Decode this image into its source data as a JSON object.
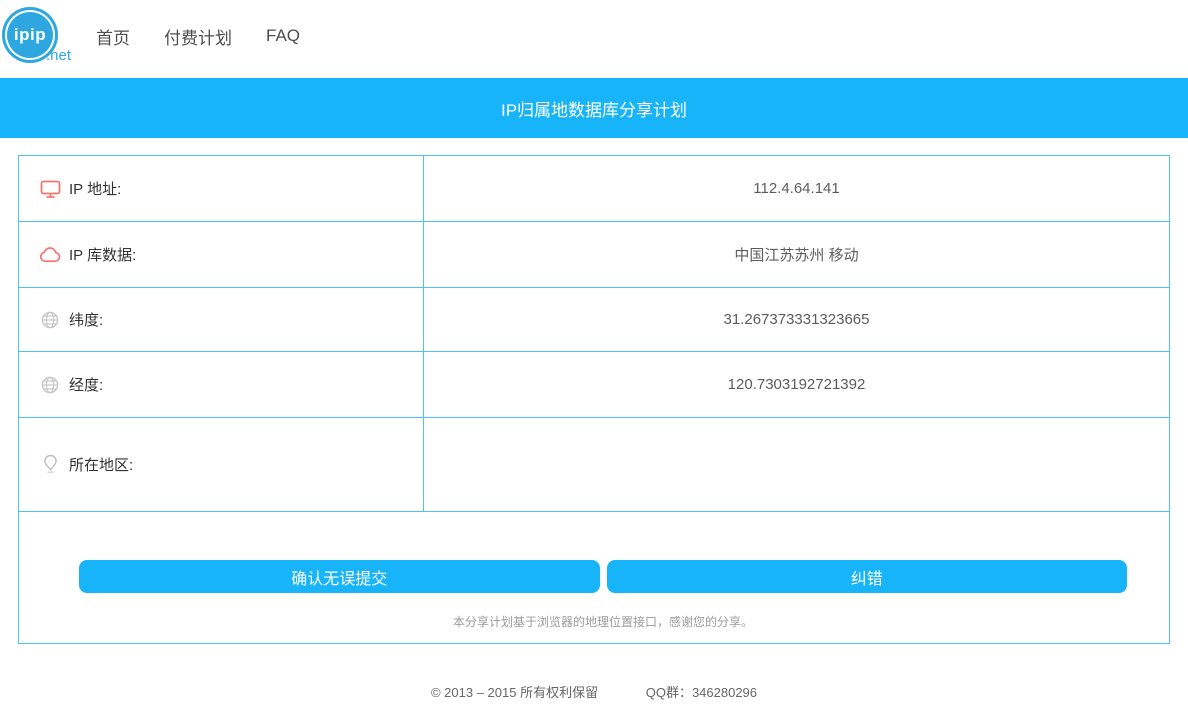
{
  "header": {
    "logo_text": "ipip",
    "logo_suffix": ".net",
    "nav": [
      {
        "label": "首页"
      },
      {
        "label": "付费计划"
      },
      {
        "label": "FAQ"
      }
    ]
  },
  "banner": {
    "title": "IP归属地数据库分享计划"
  },
  "table": {
    "rows": [
      {
        "icon": "monitor-icon",
        "label": "IP 地址:",
        "value": "112.4.64.141"
      },
      {
        "icon": "cloud-icon",
        "label": "IP 库数据:",
        "value": "中国江苏苏州 移动"
      },
      {
        "icon": "globe-icon",
        "label": "纬度:",
        "value": "31.267373331323665"
      },
      {
        "icon": "globe-icon",
        "label": "经度:",
        "value": "120.7303192721392"
      },
      {
        "icon": "pin-icon",
        "label": "所在地区:",
        "value": ""
      }
    ]
  },
  "actions": {
    "submit_label": "确认无误提交",
    "correct_label": "纠错",
    "note": "本分享计划基于浏览器的地理位置接口，感谢您的分享。"
  },
  "footer": {
    "copyright": "© 2013 – 2015 所有权利保留",
    "qq_group": "QQ群：346280296"
  },
  "colors": {
    "accent_blue": "#17b4f9",
    "border_blue": "#49c5f7",
    "logo_blue": "#2ea7e0",
    "icon_red": "#f4736b",
    "icon_gray": "#c6c6c6"
  }
}
